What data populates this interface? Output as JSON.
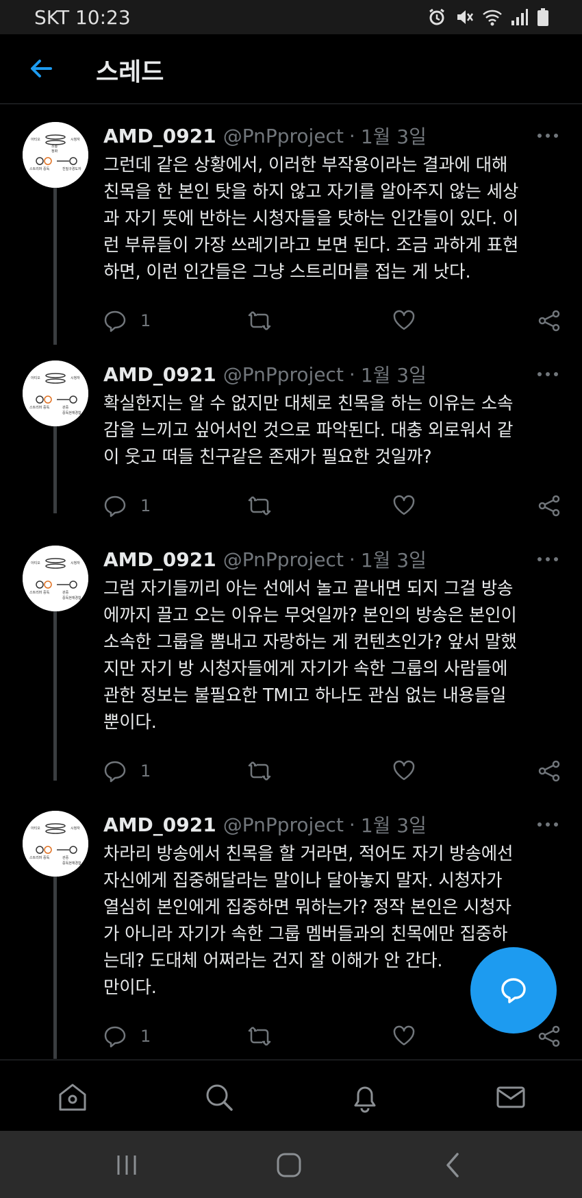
{
  "status_bar": {
    "carrier_time": "SKT 10:23",
    "icons": [
      "alarm-icon",
      "mute-icon",
      "wifi-icon",
      "signal-icon",
      "battery-icon"
    ]
  },
  "header": {
    "title": "스레드",
    "back_icon": "arrow-left-icon"
  },
  "colors": {
    "accent": "#1d9bf0",
    "background": "#000000",
    "text_primary": "#e7e9ea",
    "text_secondary": "#71767b",
    "divider": "#2f3336"
  },
  "tweets": [
    {
      "author_name": "AMD_0921",
      "author_handle": "@PnPproject",
      "separator": "·",
      "date": "1월 3일",
      "lines": [
        "그런데 같은 상황에서, 이러한 부작용이라는 결과에 대해",
        "친목을 한 본인 탓을 하지 않고 자기를 알아주지 않는 세상",
        "과 자기 뜻에 반하는 시청자들을 탓하는 인간들이 있다. 이",
        "런 부류들이 가장 쓰레기라고 보면 된다. 조금 과하게 표현",
        "하면, 이런 인간들은 그냥 스트리머를 접는 게 낫다."
      ],
      "reply_count": "1"
    },
    {
      "author_name": "AMD_0921",
      "author_handle": "@PnPproject",
      "separator": "·",
      "date": "1월 3일",
      "lines": [
        "확실한지는 알 수 없지만 대체로 친목을 하는 이유는 소속",
        "감을 느끼고 싶어서인 것으로 파악된다. 대충 외로워서 같",
        "이 웃고 떠들 친구같은 존재가 필요한 것일까?"
      ],
      "reply_count": "1"
    },
    {
      "author_name": "AMD_0921",
      "author_handle": "@PnPproject",
      "separator": "·",
      "date": "1월 3일",
      "lines": [
        "그럼 자기들끼리 아는 선에서 놀고 끝내면 되지 그걸 방송",
        "에까지 끌고 오는 이유는 무엇일까? 본인의 방송은 본인이",
        "소속한 그룹을 뽐내고 자랑하는 게 컨텐츠인가? 앞서 말했",
        "지만 자기 방 시청자들에게 자기가 속한 그룹의 사람들에",
        "관한 정보는 불필요한 TMI고 하나도 관심 없는 내용들일",
        "뿐이다."
      ],
      "reply_count": "1"
    },
    {
      "author_name": "AMD_0921",
      "author_handle": "@PnPproject",
      "separator": "·",
      "date": "1월 3일",
      "lines": [
        "차라리 방송에서 친목을 할 거라면, 적어도 자기 방송에선",
        "자신에게 집중해달라는 말이나 달아놓지 말자. 시청자가",
        "열심히 본인에게 집중하면 뭐하는가? 정작 본인은 시청자",
        "가 아니라 자기가 속한 그룹 멤버들과의 친목에만 집중하",
        "는데? 도대체 어쩌라는 건지 잘 이해가 안 간다.",
        "만이다."
      ],
      "reply_count": "1"
    }
  ],
  "avatar_labels": {
    "top_left": "아티오",
    "top_mid": "소통",
    "top_right": "시청자",
    "mid": "정화",
    "bottom_left": "스트리머 중독",
    "bottom_right": "친밀구경도자",
    "bottom_right2": "관중",
    "bottom_right3": "중독현재경험"
  },
  "fab": {
    "icon": "compose-reply-icon"
  },
  "bottom_nav": [
    "home-icon",
    "search-icon",
    "notifications-icon",
    "messages-icon"
  ],
  "system_nav": [
    "recents-icon",
    "home-button-icon",
    "back-icon"
  ]
}
